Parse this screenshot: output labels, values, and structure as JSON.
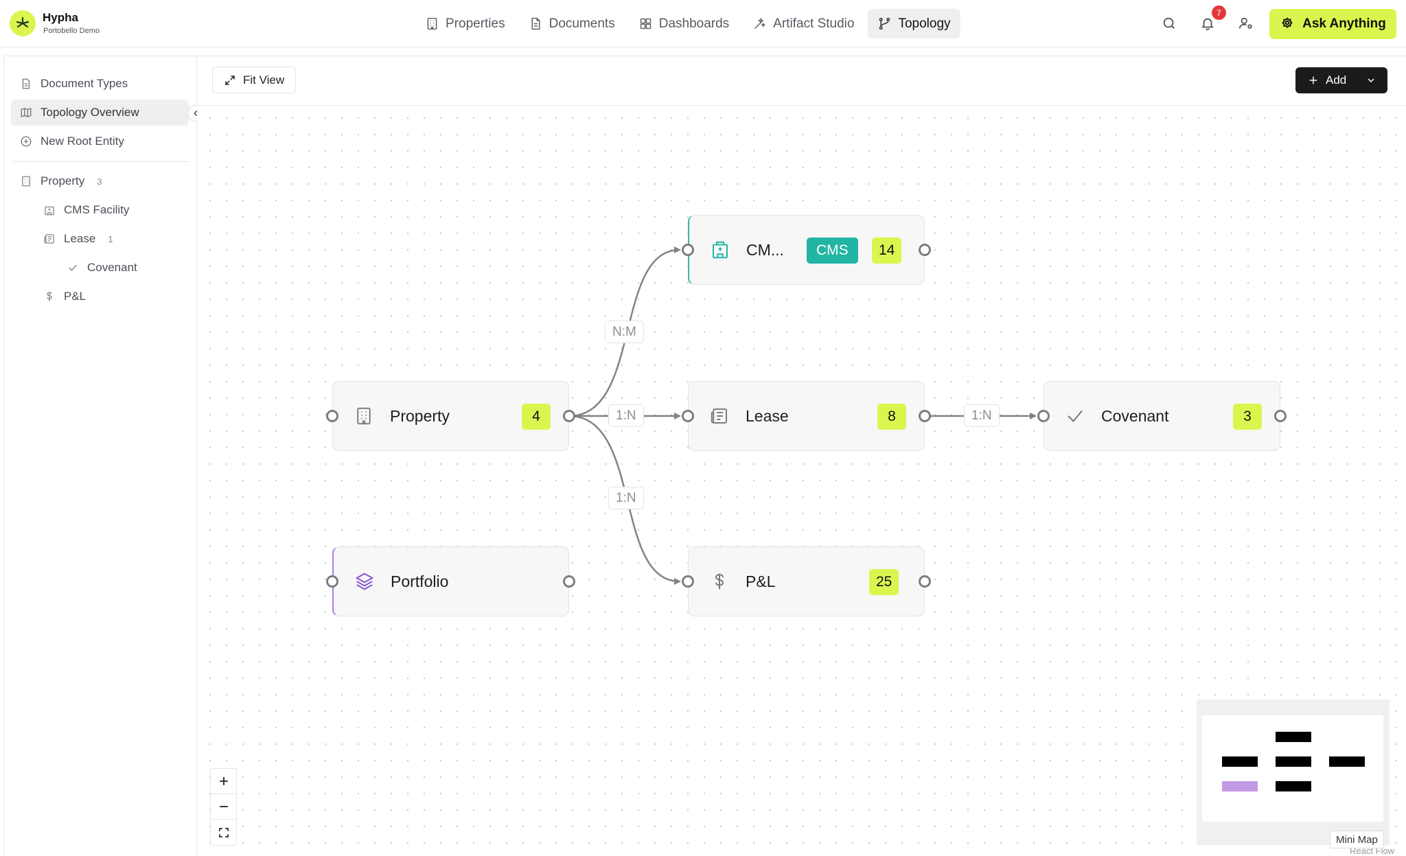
{
  "brand": {
    "name": "Hypha",
    "subtitle": "Portobello Demo"
  },
  "nav": [
    {
      "label": "Properties",
      "icon": "building-icon"
    },
    {
      "label": "Documents",
      "icon": "document-icon"
    },
    {
      "label": "Dashboards",
      "icon": "grid-icon"
    },
    {
      "label": "Artifact Studio",
      "icon": "wand-icon"
    },
    {
      "label": "Topology",
      "icon": "git-branch-icon",
      "active": true
    }
  ],
  "notifications": {
    "count": "7"
  },
  "ask_button": {
    "label": "Ask Anything"
  },
  "sidebar": {
    "top_items": [
      {
        "label": "Document Types",
        "icon": "document-icon"
      },
      {
        "label": "Topology Overview",
        "icon": "map-icon",
        "active": true
      },
      {
        "label": "New Root Entity",
        "icon": "plus-circle-icon"
      }
    ],
    "tree": [
      {
        "label": "Property",
        "count": "3",
        "icon": "building-icon",
        "level": 0
      },
      {
        "label": "CMS Facility",
        "count": "",
        "icon": "hospital-icon",
        "level": 1
      },
      {
        "label": "Lease",
        "count": "1",
        "icon": "newspaper-icon",
        "level": 1
      },
      {
        "label": "Covenant",
        "count": "",
        "icon": "check-icon",
        "level": 2
      },
      {
        "label": "P&L",
        "count": "",
        "icon": "dollar-icon",
        "level": 1
      }
    ]
  },
  "toolbar": {
    "fit_view": "Fit View",
    "add": "Add"
  },
  "nodes": {
    "property": {
      "title": "Property",
      "count": "4"
    },
    "cms": {
      "title": "CM...",
      "tag": "CMS",
      "count": "14"
    },
    "lease": {
      "title": "Lease",
      "count": "8"
    },
    "covenant": {
      "title": "Covenant",
      "count": "3"
    },
    "portfolio": {
      "title": "Portfolio"
    },
    "pnl": {
      "title": "P&L",
      "count": "25"
    }
  },
  "edges": {
    "property_cms": "N:M",
    "property_lease": "1:N",
    "property_pnl": "1:N",
    "lease_covenant": "1:N"
  },
  "minimap": {
    "label": "Mini Map",
    "attribution": "React Flow"
  },
  "colors": {
    "accent": "#dcf54e",
    "cms_tag": "#22b5a4",
    "portfolio": "#a77de0",
    "edge": "#808387"
  }
}
